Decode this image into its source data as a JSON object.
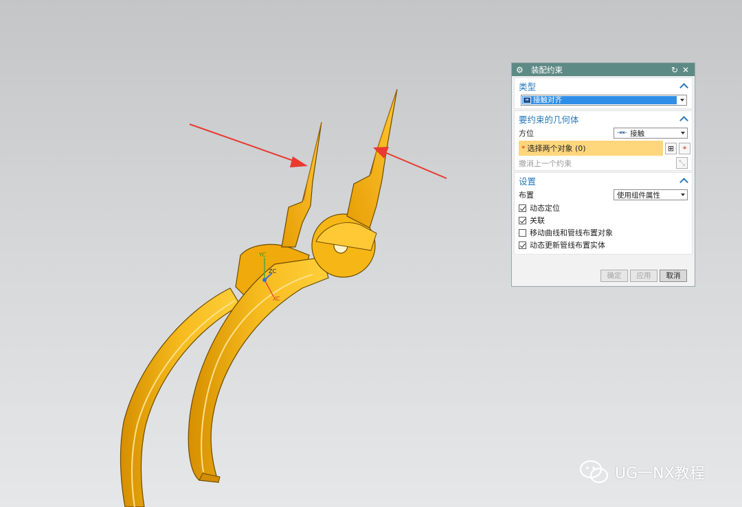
{
  "dialog": {
    "title": "装配约束",
    "type_section": {
      "header": "类型",
      "selected_type": "接触对齐"
    },
    "geometry_section": {
      "header": "要约束的几何体",
      "orientation_label": "方位",
      "orientation_value": "接触",
      "select_objects_label": "选择两个对象 (0)",
      "undo_label": "撤消上一个约束"
    },
    "settings_section": {
      "header": "设置",
      "layout_label": "布置",
      "layout_value": "使用组件属性",
      "checkboxes": [
        {
          "label": "动态定位",
          "checked": true
        },
        {
          "label": "关联",
          "checked": true
        },
        {
          "label": "移动曲线和管线布置对象",
          "checked": false
        },
        {
          "label": "动态更新管线布置实体",
          "checked": true
        }
      ]
    },
    "buttons": {
      "ok": "确定",
      "apply": "应用",
      "cancel": "取消"
    }
  },
  "triad": {
    "yc": "YC",
    "zc": "ZC",
    "xc": "XC"
  },
  "watermark": "UG一NX教程",
  "colors": {
    "titlebar": "#5e8a85",
    "section_header": "#2878b8",
    "selected_highlight": "#2f8fe8",
    "pick_box": "#fed67c",
    "part_yellow": "#f3b312",
    "arrow_red": "#e83a2f"
  }
}
